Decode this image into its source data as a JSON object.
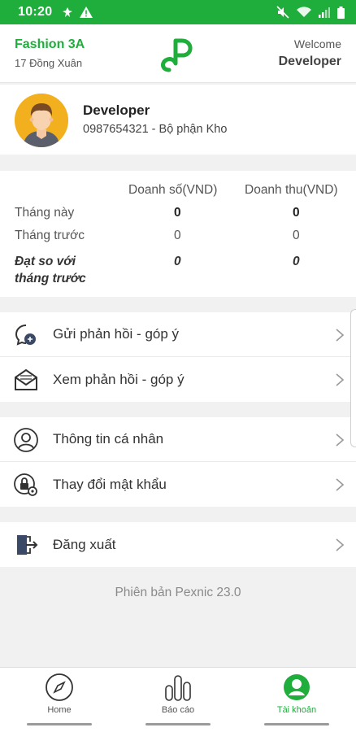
{
  "status_bar": {
    "time": "10:20"
  },
  "header": {
    "shop_name": "Fashion 3A",
    "shop_address": "17 Đồng Xuân",
    "welcome_label": "Welcome",
    "user_name": "Developer",
    "logo_icon": "pexnic-logo"
  },
  "profile": {
    "name": "Developer",
    "details": "0987654321 - Bộ phận Kho",
    "avatar_icon": "user-avatar"
  },
  "stats": {
    "col_sales": "Doanh số(VND)",
    "col_revenue": "Doanh thu(VND)",
    "rows": [
      {
        "label": "Tháng này",
        "sales": "0",
        "revenue": "0"
      },
      {
        "label": "Tháng trước",
        "sales": "0",
        "revenue": "0"
      }
    ],
    "compare_label_line1": "Đạt so với",
    "compare_label_line2": "tháng trước",
    "compare_sales": "0",
    "compare_revenue": "0"
  },
  "menu": {
    "feedback_send": "Gửi phản hồi - góp ý",
    "feedback_view": "Xem phản hồi - góp ý",
    "personal_info": "Thông tin cá nhân",
    "change_password": "Thay đổi mật khẩu",
    "logout": "Đăng xuất"
  },
  "version": "Phiên bản Pexnic 23.0",
  "bottom_nav": {
    "home": "Home",
    "report": "Báo cáo",
    "account": "Tài khoản",
    "active": "account"
  },
  "colors": {
    "brand_green": "#1fae3c"
  }
}
